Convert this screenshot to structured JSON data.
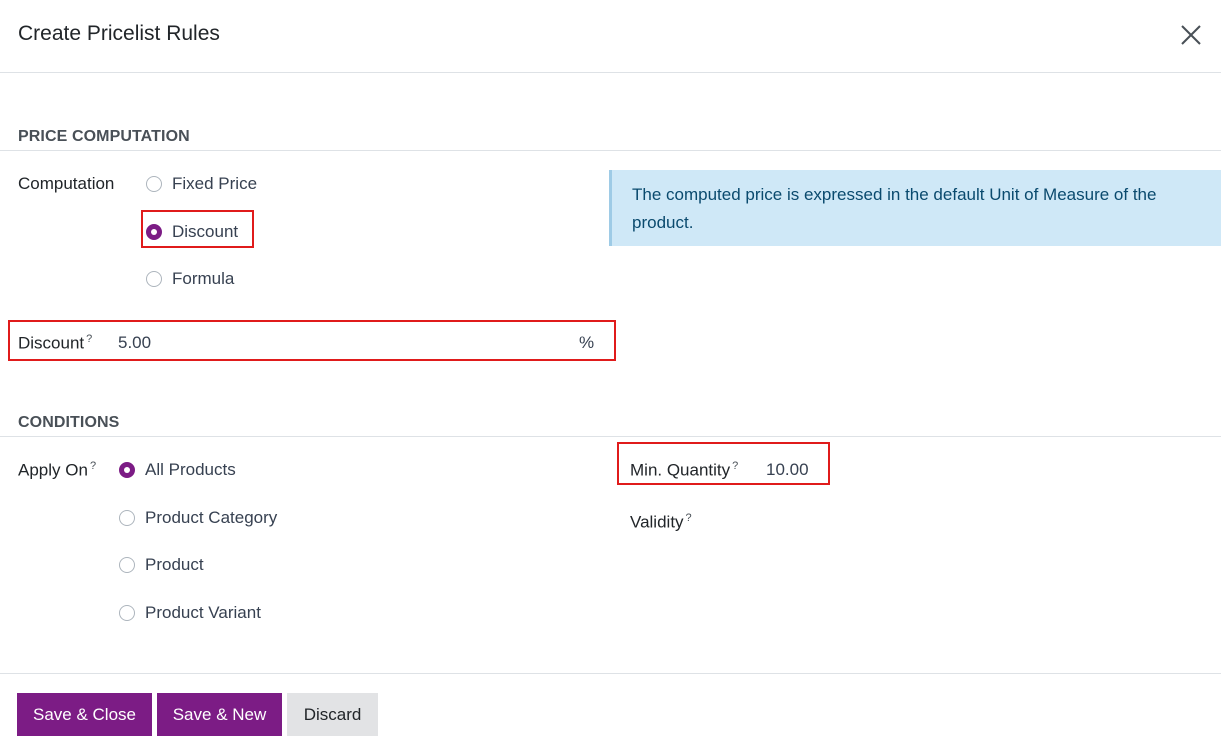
{
  "dialog": {
    "title": "Create Pricelist Rules",
    "close_icon": "close-icon"
  },
  "price_computation": {
    "section_title": "PRICE COMPUTATION",
    "computation_label": "Computation",
    "options": [
      {
        "label": "Fixed Price",
        "checked": false
      },
      {
        "label": "Discount",
        "checked": true
      },
      {
        "label": "Formula",
        "checked": false
      }
    ],
    "info_text": "The computed price is expressed in the default Unit of Measure of the product.",
    "discount_label": "Discount",
    "discount_help": "?",
    "discount_value": "5.00",
    "discount_unit": "%"
  },
  "conditions": {
    "section_title": "CONDITIONS",
    "apply_on_label": "Apply On",
    "apply_on_help": "?",
    "options": [
      {
        "label": "All Products",
        "checked": true
      },
      {
        "label": "Product Category",
        "checked": false
      },
      {
        "label": "Product",
        "checked": false
      },
      {
        "label": "Product Variant",
        "checked": false
      }
    ],
    "min_quantity_label": "Min. Quantity",
    "min_quantity_help": "?",
    "min_quantity_value": "10.00",
    "validity_label": "Validity",
    "validity_help": "?"
  },
  "footer": {
    "save_close_label": "Save & Close",
    "save_new_label": "Save & New",
    "discard_label": "Discard"
  },
  "colors": {
    "primary": "#7c1c85",
    "highlight": "#e01b1b",
    "info_background": "#cfe8f7",
    "info_text": "#0a4a6e"
  }
}
